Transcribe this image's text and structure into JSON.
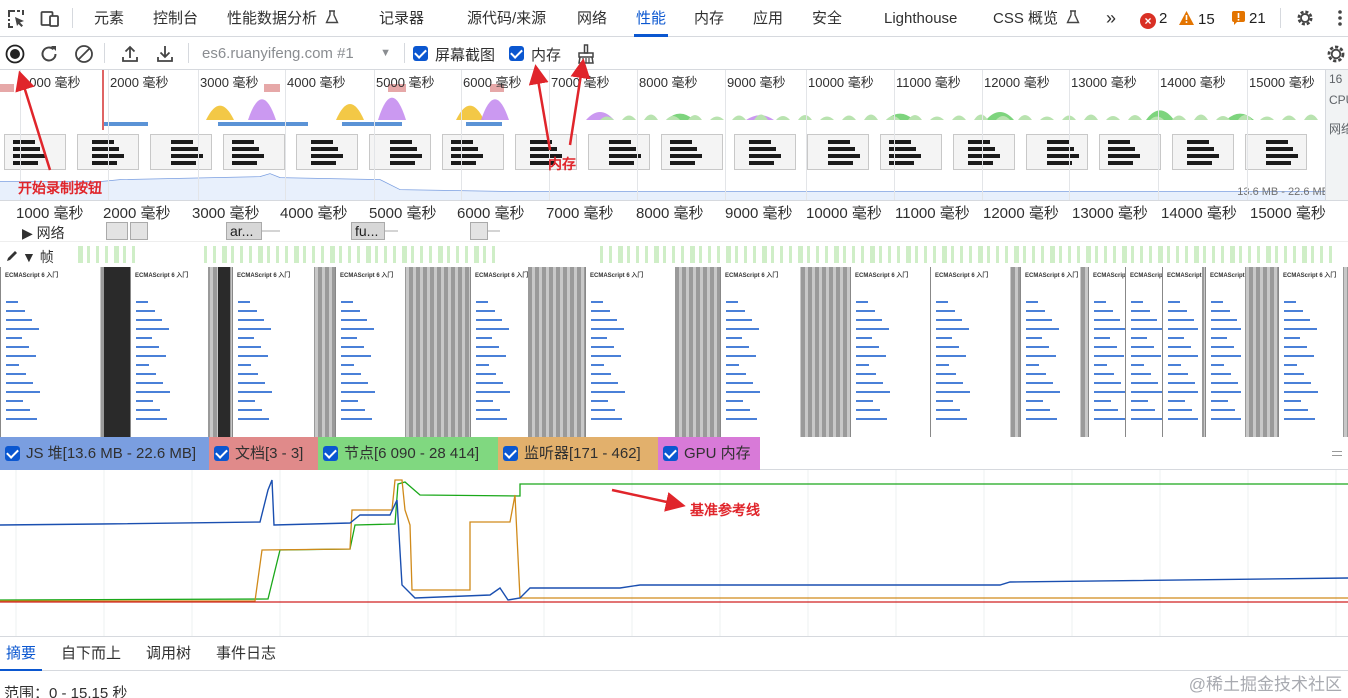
{
  "tabs": [
    {
      "label": "元素"
    },
    {
      "label": "控制台"
    },
    {
      "label": "性能数据分析"
    },
    {
      "label": "记录器"
    },
    {
      "label": "源代码/来源"
    },
    {
      "label": "网络"
    },
    {
      "label": "性能",
      "active": true
    },
    {
      "label": "内存"
    },
    {
      "label": "应用"
    },
    {
      "label": "安全"
    },
    {
      "label": "Lighthouse"
    },
    {
      "label": "CSS 概览"
    }
  ],
  "status": {
    "errors": "2",
    "warnings": "15",
    "issues": "21"
  },
  "toolbar": {
    "url_select": "es6.ruanyifeng.com #1",
    "screenshots_label": "屏幕截图",
    "memory_label": "内存"
  },
  "overview": {
    "ticks": [
      "1000 毫秒",
      "2000 毫秒",
      "3000 毫秒",
      "4000 毫秒",
      "5000 毫秒",
      "6000 毫秒",
      "7000 毫秒",
      "8000 毫秒",
      "9000 毫秒",
      "10000 毫秒",
      "11000 毫秒",
      "12000 毫秒",
      "13000 毫秒",
      "14000 毫秒",
      "15000 毫秒"
    ],
    "memory_range": "13.6 MB - 22.6 MB",
    "side_labels": [
      "16",
      "CPU",
      "网络"
    ]
  },
  "main": {
    "ticks": [
      "1000 毫秒",
      "2000 毫秒",
      "3000 毫秒",
      "4000 毫秒",
      "5000 毫秒",
      "6000 毫秒",
      "7000 毫秒",
      "8000 毫秒",
      "9000 毫秒",
      "10000 毫秒",
      "11000 毫秒",
      "12000 毫秒",
      "13000 毫秒",
      "14000 毫秒",
      "15000 毫秒"
    ],
    "network_label": "网络",
    "network_chips": [
      "ar...",
      "fu..."
    ],
    "frames_label": "帧",
    "page_title": "ECMAScript 6 入门"
  },
  "counters": [
    {
      "label": "JS 堆[13.6 MB - 22.6 MB]",
      "color": "#7a9ee0"
    },
    {
      "label": "文档[3 - 3]",
      "color": "#e08a8a"
    },
    {
      "label": "节点[6 090 - 28 414]",
      "color": "#80d880"
    },
    {
      "label": "监听器[171 - 462]",
      "color": "#e2b06c"
    },
    {
      "label": "GPU 内存",
      "color": "#d87ad8"
    }
  ],
  "bottom_tabs": [
    {
      "label": "摘要",
      "active": true
    },
    {
      "label": "自下而上"
    },
    {
      "label": "调用树"
    },
    {
      "label": "事件日志"
    }
  ],
  "summary": {
    "range": "范围：0 - 15.15 秒"
  },
  "annotations": {
    "record": "开始录制按钮",
    "memory": "内存",
    "baseline": "基准参考线"
  },
  "watermark": "@稀土掘金技术社区",
  "colors": {
    "accent": "#0b57d0",
    "annotation": "#e0252b",
    "js_heap": "#1a4fb0",
    "documents": "#d02020",
    "nodes": "#1aa81a",
    "listeners": "#d08a1a"
  }
}
